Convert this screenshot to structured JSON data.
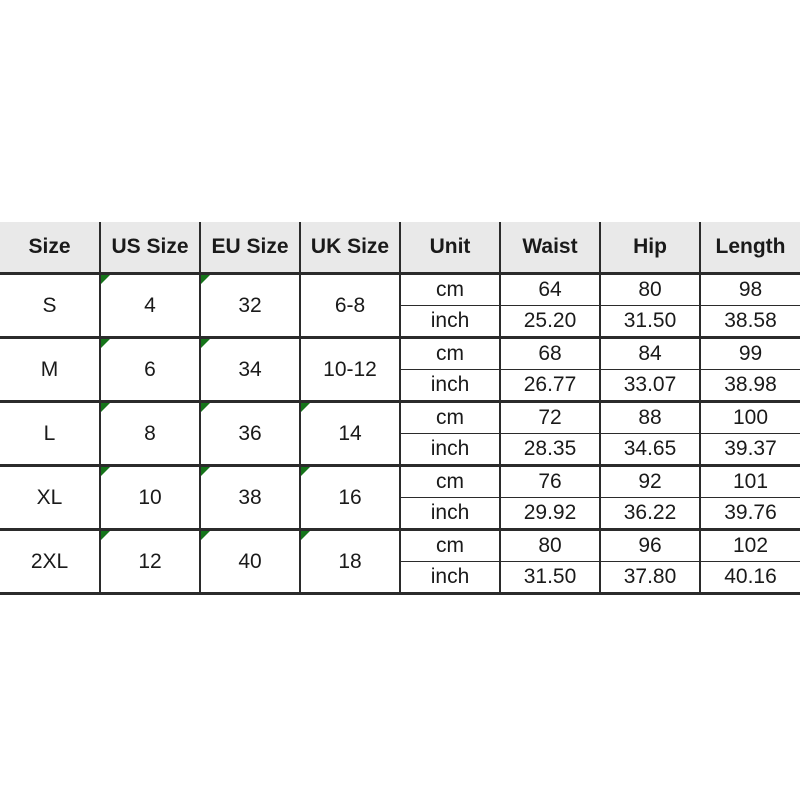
{
  "table": {
    "headers": [
      {
        "key": "size",
        "label": "Size"
      },
      {
        "key": "us",
        "label": "US Size"
      },
      {
        "key": "eu",
        "label": "EU Size"
      },
      {
        "key": "uk",
        "label": "UK Size"
      },
      {
        "key": "unit",
        "label": "Unit"
      },
      {
        "key": "waist",
        "label": "Waist"
      },
      {
        "key": "hip",
        "label": "Hip"
      },
      {
        "key": "length",
        "label": "Length"
      }
    ],
    "units": {
      "metric": "cm",
      "imperial": "inch"
    },
    "marker_color": "#15741a",
    "header_background": "#e9e9e9",
    "border_color": "#2b2b2b",
    "rows": [
      {
        "size": "S",
        "us": "4",
        "eu": "32",
        "uk": "6-8",
        "cm": {
          "unit": "cm",
          "waist": "64",
          "hip": "80",
          "length": "98"
        },
        "inch": {
          "unit": "inch",
          "waist": "25.20",
          "hip": "31.50",
          "length": "38.58"
        },
        "markers": {
          "us": true,
          "eu": true,
          "uk": false
        }
      },
      {
        "size": "M",
        "us": "6",
        "eu": "34",
        "uk": "10-12",
        "cm": {
          "unit": "cm",
          "waist": "68",
          "hip": "84",
          "length": "99"
        },
        "inch": {
          "unit": "inch",
          "waist": "26.77",
          "hip": "33.07",
          "length": "38.98"
        },
        "markers": {
          "us": true,
          "eu": true,
          "uk": false
        }
      },
      {
        "size": "L",
        "us": "8",
        "eu": "36",
        "uk": "14",
        "cm": {
          "unit": "cm",
          "waist": "72",
          "hip": "88",
          "length": "100"
        },
        "inch": {
          "unit": "inch",
          "waist": "28.35",
          "hip": "34.65",
          "length": "39.37"
        },
        "markers": {
          "us": true,
          "eu": true,
          "uk": true
        }
      },
      {
        "size": "XL",
        "us": "10",
        "eu": "38",
        "uk": "16",
        "cm": {
          "unit": "cm",
          "waist": "76",
          "hip": "92",
          "length": "101"
        },
        "inch": {
          "unit": "inch",
          "waist": "29.92",
          "hip": "36.22",
          "length": "39.76"
        },
        "markers": {
          "us": true,
          "eu": true,
          "uk": true
        }
      },
      {
        "size": "2XL",
        "us": "12",
        "eu": "40",
        "uk": "18",
        "cm": {
          "unit": "cm",
          "waist": "80",
          "hip": "96",
          "length": "102"
        },
        "inch": {
          "unit": "inch",
          "waist": "31.50",
          "hip": "37.80",
          "length": "40.16"
        },
        "markers": {
          "us": true,
          "eu": true,
          "uk": true
        }
      }
    ]
  }
}
